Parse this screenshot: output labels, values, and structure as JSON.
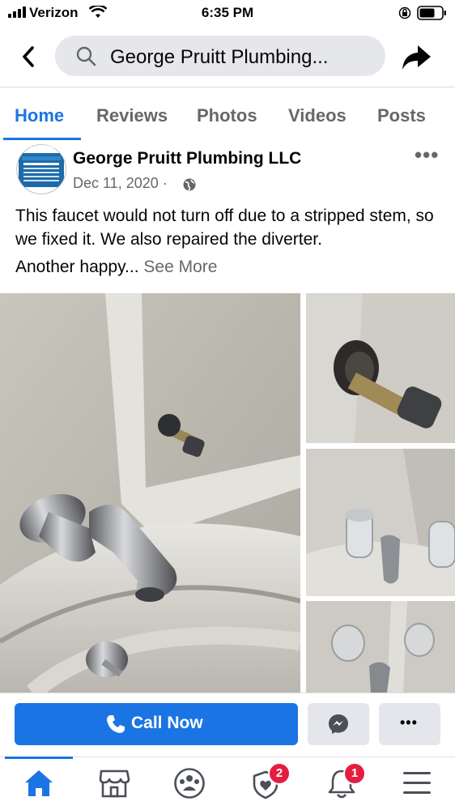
{
  "status_bar": {
    "carrier": "Verizon",
    "time": "6:35 PM"
  },
  "header": {
    "search_text": "George Pruitt Plumbing..."
  },
  "tabs": [
    {
      "label": "Home",
      "active": true
    },
    {
      "label": "Reviews"
    },
    {
      "label": "Photos"
    },
    {
      "label": "Videos"
    },
    {
      "label": "Posts"
    }
  ],
  "post": {
    "page_name": "George Pruitt Plumbing LLC",
    "date": "Dec 11, 2020 ·",
    "text": "This faucet would not turn off due to a stripped stem, so we fixed it. We also repaired the diverter.",
    "text_continued": "Another happy...",
    "see_more": "See More",
    "avatar_text": "PLUMBING"
  },
  "actions": {
    "call_now": "Call Now"
  },
  "bottom_nav": {
    "items": [
      "home-icon",
      "marketplace-icon",
      "groups-icon",
      "dating-icon",
      "notifications-icon",
      "menu-icon"
    ],
    "badges": {
      "dating": "2",
      "notifications": "1"
    }
  },
  "colors": {
    "accent": "#1b74e4",
    "badge": "#e41e3f"
  }
}
